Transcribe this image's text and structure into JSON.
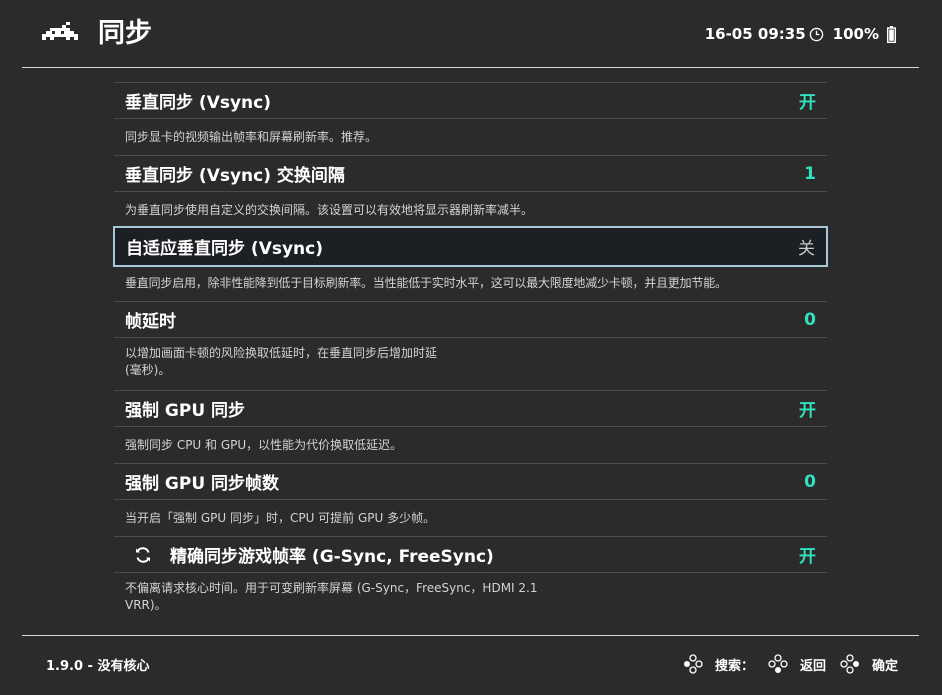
{
  "header": {
    "title": "同步",
    "datetime": "16-05 09:35",
    "battery": "100%"
  },
  "menu": {
    "items": [
      {
        "label": "垂直同步 (Vsync)",
        "value": "开",
        "description": "同步显卡的视频输出帧率和屏幕刷新率。推荐。"
      },
      {
        "label": "垂直同步 (Vsync) 交换间隔",
        "value": "1",
        "description": "为垂直同步使用自定义的交换间隔。该设置可以有效地将显示器刷新率减半。"
      },
      {
        "label": "自适应垂直同步 (Vsync)",
        "value": "关",
        "description": "垂直同步启用，除非性能降到低于目标刷新率。当性能低于实时水平，这可以最大限度地减少卡顿，并且更加节能。"
      },
      {
        "label": "帧延时",
        "value": "0",
        "description_line1": "以增加画面卡顿的风险换取低延时，在垂直同步后增加时延",
        "description_line2": "(毫秒)。"
      },
      {
        "label": "强制 GPU 同步",
        "value": "开",
        "description": "强制同步 CPU 和 GPU，以性能为代价换取低延迟。"
      },
      {
        "label": "强制 GPU 同步帧数",
        "value": "0",
        "description": "当开启「强制 GPU 同步」时，CPU 可提前 GPU 多少帧。"
      },
      {
        "label": "精确同步游戏帧率 (G-Sync, FreeSync)",
        "value": "开",
        "description_line1": "不偏离请求核心时间。用于可变刷新率屏幕 (G-Sync，FreeSync，HDMI 2.1",
        "description_line2": "VRR)。"
      }
    ]
  },
  "footer": {
    "version": "1.9.0 - 没有核心",
    "search": "搜索：",
    "back": "返回",
    "confirm": "确定"
  },
  "colors": {
    "background": "#2b2b2b",
    "accent_on": "#31e2c0",
    "selection_border": "#a9c9d9"
  }
}
